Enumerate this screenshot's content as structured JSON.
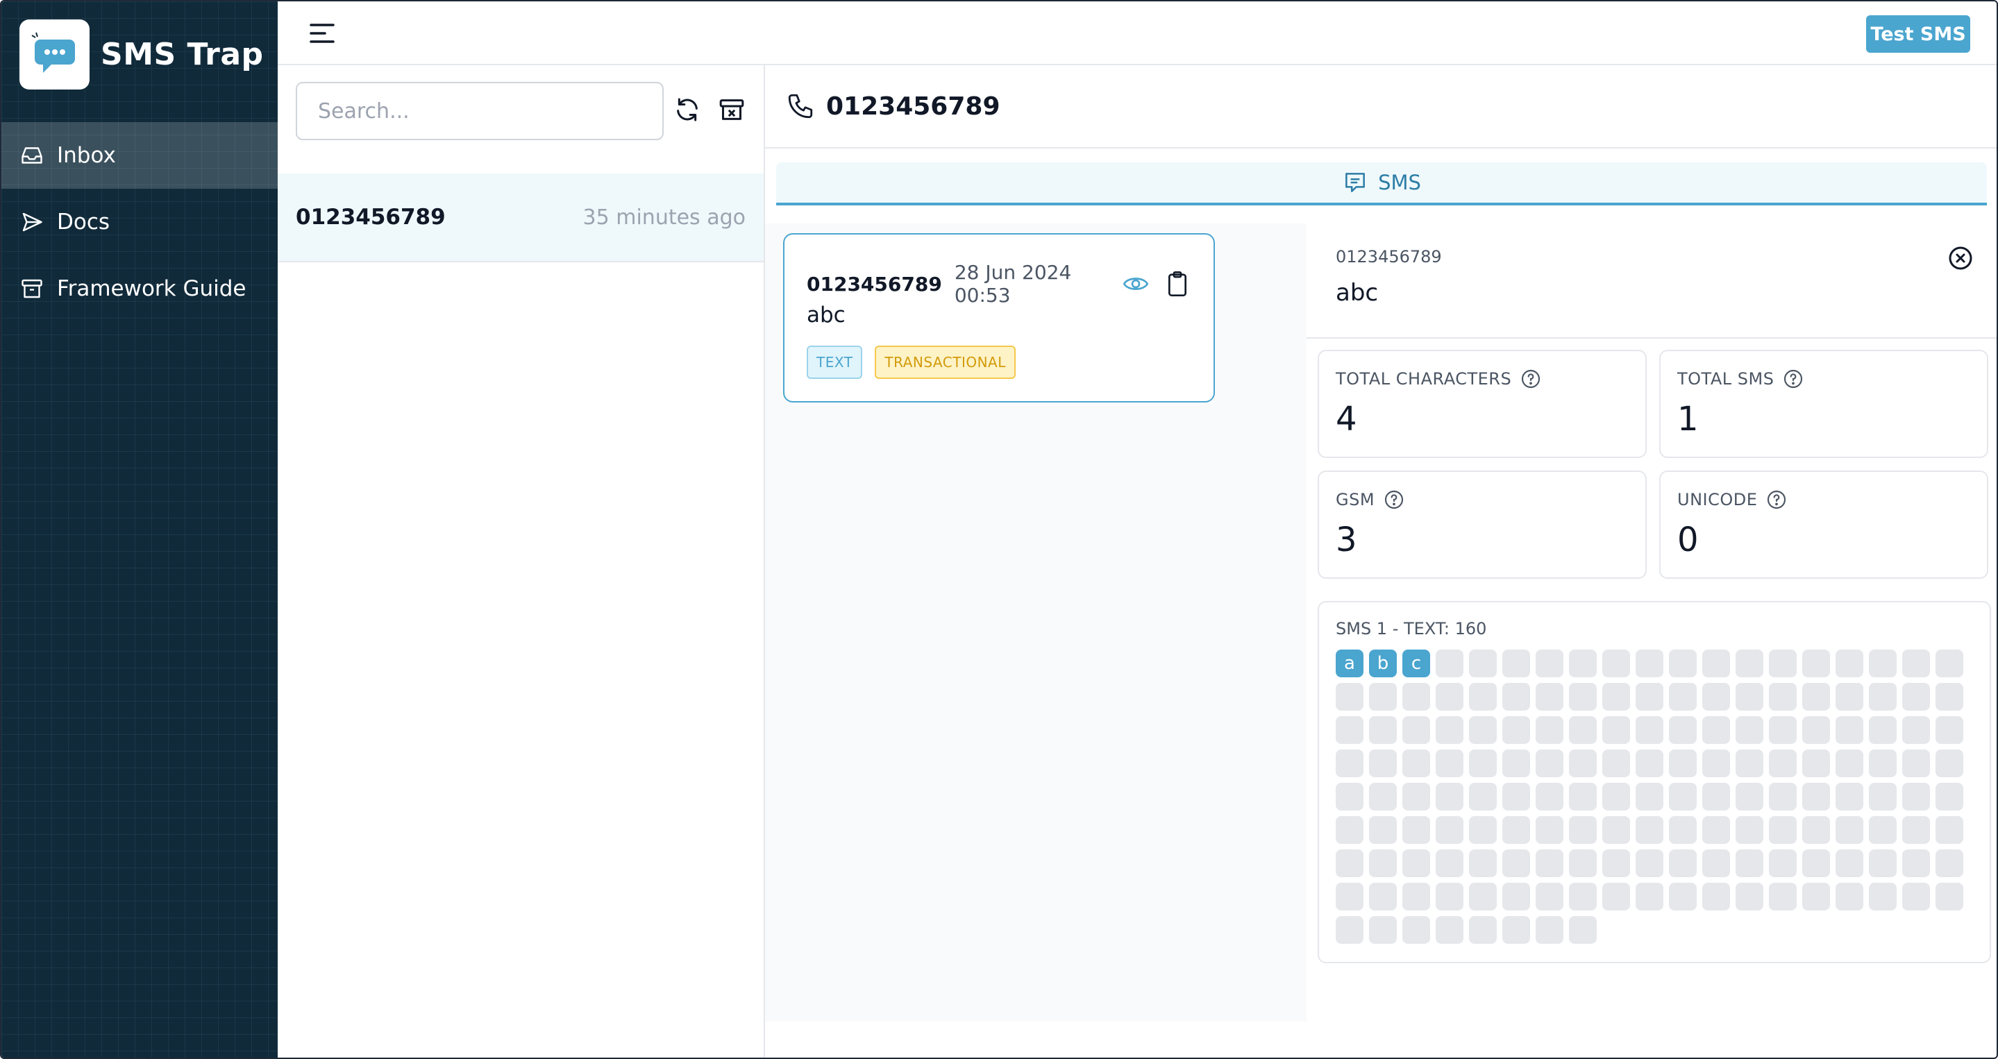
{
  "app": {
    "title": "SMS Trap"
  },
  "sidebar": {
    "items": [
      {
        "label": "Inbox",
        "icon": "inbox-icon",
        "active": true
      },
      {
        "label": "Docs",
        "icon": "send-icon",
        "active": false
      },
      {
        "label": "Framework Guide",
        "icon": "archive-icon",
        "active": false
      }
    ]
  },
  "header": {
    "test_button": "Test SMS"
  },
  "list": {
    "search_placeholder": "Search...",
    "conversations": [
      {
        "number": "0123456789",
        "time": "35 minutes ago"
      }
    ]
  },
  "detail": {
    "phone": "0123456789",
    "tab_label": "SMS",
    "message": {
      "from": "0123456789",
      "date": "28 Jun 2024 00:53",
      "text": "abc",
      "badges": [
        "TEXT",
        "TRANSACTIONAL"
      ]
    },
    "info": {
      "from": "0123456789",
      "text": "abc",
      "stats": [
        {
          "label": "TOTAL CHARACTERS",
          "value": "4"
        },
        {
          "label": "TOTAL SMS",
          "value": "1"
        },
        {
          "label": "GSM",
          "value": "3"
        },
        {
          "label": "UNICODE",
          "value": "0"
        }
      ],
      "segment_label": "SMS 1 - TEXT: 160",
      "segment_chars": [
        "a",
        "b",
        "c"
      ],
      "segment_capacity": 160
    }
  },
  "colors": {
    "accent": "#4aa5cf",
    "sidebar_bg": "#102a3a",
    "badge_warning": "#d29a0a"
  }
}
